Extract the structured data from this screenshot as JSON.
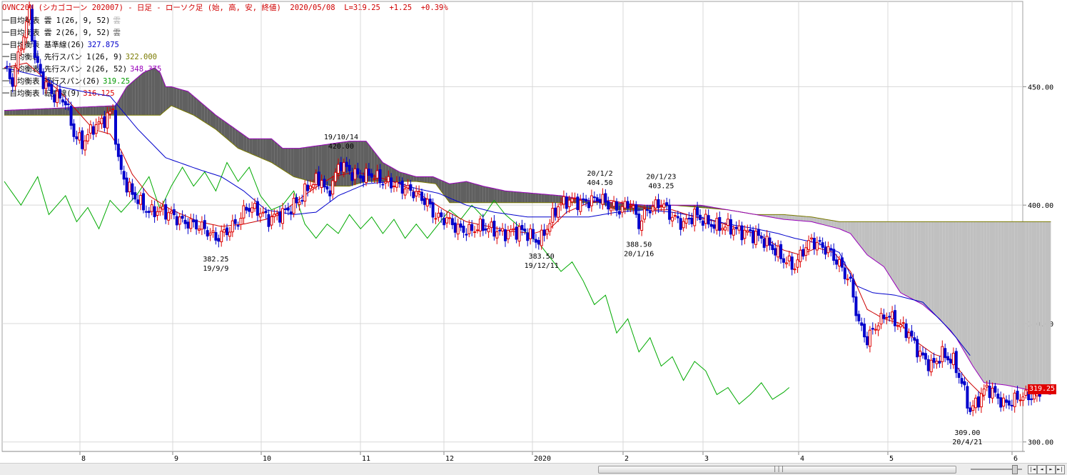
{
  "header": {
    "title": "OVNC20N (シカゴコーン 202007) - 日足 - ローソク足 (始, 高, 安, 終値)  2020/05/08  L=319.25  +1.25  +0.39%"
  },
  "legend": [
    {
      "label": "一目均衡表 雲 1(26, 9, 52)",
      "value": "雲",
      "color": "#b0b0b0"
    },
    {
      "label": "一目均衡表 雲 2(26, 9, 52)",
      "value": "雲",
      "color": "#606060"
    },
    {
      "label": "一目均衡表 基準線(26)",
      "value": "327.875",
      "color": "#0000cc"
    },
    {
      "label": "一目均衡表 先行スパン 1(26, 9)",
      "value": "322.000",
      "color": "#7a7a00"
    },
    {
      "label": "一目均衡表 先行スパン 2(26, 52)",
      "value": "348.375",
      "color": "#9900bb"
    },
    {
      "label": "一目均衡表 遅行スパン(26)",
      "value": "319.25",
      "color": "#009900"
    },
    {
      "label": "一目均衡表 転換線(9)",
      "value": "316.125",
      "color": "#dd0000"
    }
  ],
  "price_tag": "319.25",
  "scrollbar": {
    "grip": "|||"
  },
  "nav_buttons": [
    "|◄",
    "◄",
    "►",
    "►|"
  ],
  "colors": {
    "up_candle": "#dd0000",
    "down_candle": "#0000cc",
    "cloud_up": "#c0c0c0",
    "cloud_down": "#606060",
    "kijun": "#0000cc",
    "tenkan": "#cc0000",
    "chikou": "#00aa00",
    "senkou1": "#7a7a00",
    "senkou2": "#9900bb",
    "grid": "#d8d8d8"
  },
  "chart_data": {
    "type": "candlestick",
    "ylim": [
      296,
      486
    ],
    "y_ticks": [
      450,
      400,
      350,
      300
    ],
    "y_tick_labels": [
      "450.00",
      "400.00",
      "350.00",
      "300.00"
    ],
    "x_tick_labels": [
      "8",
      "9",
      "10",
      "11",
      "12",
      "2020",
      "2",
      "3",
      "4",
      "5",
      "6"
    ],
    "annotations": [
      {
        "text": "19/10/14",
        "bar": 121,
        "value": 420.0,
        "anchor": "above"
      },
      {
        "text": "420.00",
        "bar": 121,
        "value": 420.0,
        "anchor": "above2"
      },
      {
        "text": "20/1/2",
        "bar": 214,
        "value": 404.5,
        "anchor": "above"
      },
      {
        "text": "404.50",
        "bar": 214,
        "value": 404.5,
        "anchor": "above2"
      },
      {
        "text": "20/1/23",
        "bar": 236,
        "value": 403.25,
        "anchor": "above"
      },
      {
        "text": "403.25",
        "bar": 236,
        "value": 403.25,
        "anchor": "above2"
      },
      {
        "text": "382.25",
        "bar": 76,
        "value": 382.25,
        "anchor": "below"
      },
      {
        "text": "19/9/9",
        "bar": 76,
        "value": 382.25,
        "anchor": "below2"
      },
      {
        "text": "383.50",
        "bar": 193,
        "value": 383.5,
        "anchor": "below"
      },
      {
        "text": "19/12/11",
        "bar": 193,
        "value": 383.5,
        "anchor": "below2"
      },
      {
        "text": "388.50",
        "bar": 228,
        "value": 388.5,
        "anchor": "below"
      },
      {
        "text": "20/1/16",
        "bar": 228,
        "value": 388.5,
        "anchor": "below2"
      },
      {
        "text": "309.00",
        "bar": 346,
        "value": 309.0,
        "anchor": "below"
      },
      {
        "text": "20/4/21",
        "bar": 346,
        "value": 309.0,
        "anchor": "below2"
      }
    ],
    "anchors": [
      [
        0,
        458
      ],
      [
        3,
        452
      ],
      [
        6,
        468
      ],
      [
        8,
        476
      ],
      [
        9,
        482
      ],
      [
        11,
        462
      ],
      [
        14,
        452
      ],
      [
        18,
        446
      ],
      [
        22,
        444
      ],
      [
        25,
        430
      ],
      [
        28,
        426
      ],
      [
        32,
        433
      ],
      [
        35,
        435
      ],
      [
        39,
        440
      ],
      [
        41,
        418
      ],
      [
        44,
        408
      ],
      [
        48,
        402
      ],
      [
        52,
        397
      ],
      [
        56,
        398
      ],
      [
        60,
        396
      ],
      [
        64,
        393
      ],
      [
        68,
        392
      ],
      [
        72,
        390
      ],
      [
        76,
        386
      ],
      [
        80,
        389
      ],
      [
        84,
        393
      ],
      [
        87,
        399
      ],
      [
        91,
        398
      ],
      [
        95,
        394
      ],
      [
        99,
        396
      ],
      [
        102,
        398
      ],
      [
        106,
        402
      ],
      [
        110,
        409
      ],
      [
        114,
        411
      ],
      [
        116,
        404
      ],
      [
        119,
        413
      ],
      [
        121,
        418
      ],
      [
        124,
        414
      ],
      [
        128,
        412
      ],
      [
        132,
        413
      ],
      [
        136,
        410
      ],
      [
        140,
        409
      ],
      [
        144,
        407
      ],
      [
        148,
        405
      ],
      [
        152,
        401
      ],
      [
        155,
        395
      ],
      [
        159,
        394
      ],
      [
        163,
        390
      ],
      [
        167,
        389
      ],
      [
        171,
        391
      ],
      [
        175,
        390
      ],
      [
        179,
        388
      ],
      [
        183,
        389
      ],
      [
        187,
        389
      ],
      [
        191,
        385
      ],
      [
        193,
        386
      ],
      [
        196,
        393
      ],
      [
        199,
        400
      ],
      [
        203,
        402
      ],
      [
        207,
        401
      ],
      [
        211,
        402
      ],
      [
        214,
        403
      ],
      [
        217,
        400
      ],
      [
        221,
        398
      ],
      [
        225,
        401
      ],
      [
        228,
        392
      ],
      [
        231,
        398
      ],
      [
        236,
        401
      ],
      [
        240,
        395
      ],
      [
        244,
        392
      ],
      [
        248,
        396
      ],
      [
        252,
        393
      ],
      [
        256,
        391
      ],
      [
        260,
        391
      ],
      [
        264,
        389
      ],
      [
        268,
        388
      ],
      [
        272,
        386
      ],
      [
        276,
        382
      ],
      [
        280,
        377
      ],
      [
        284,
        374
      ],
      [
        287,
        381
      ],
      [
        290,
        385
      ],
      [
        293,
        383
      ],
      [
        296,
        381
      ],
      [
        300,
        375
      ],
      [
        304,
        367
      ],
      [
        307,
        350
      ],
      [
        310,
        343
      ],
      [
        313,
        349
      ],
      [
        317,
        354
      ],
      [
        321,
        350
      ],
      [
        325,
        346
      ],
      [
        329,
        337
      ],
      [
        333,
        332
      ],
      [
        337,
        337
      ],
      [
        341,
        334
      ],
      [
        344,
        325
      ],
      [
        347,
        313
      ],
      [
        350,
        318
      ],
      [
        353,
        323
      ],
      [
        356,
        320
      ],
      [
        359,
        316
      ],
      [
        362,
        317
      ],
      [
        365,
        319.25
      ]
    ],
    "tenkan_anchors": [
      [
        0,
        458
      ],
      [
        8,
        460
      ],
      [
        14,
        454
      ],
      [
        20,
        448
      ],
      [
        26,
        440
      ],
      [
        32,
        432
      ],
      [
        38,
        430
      ],
      [
        42,
        423
      ],
      [
        46,
        413
      ],
      [
        52,
        404
      ],
      [
        60,
        398
      ],
      [
        70,
        393
      ],
      [
        78,
        391
      ],
      [
        86,
        392
      ],
      [
        94,
        394
      ],
      [
        102,
        399
      ],
      [
        110,
        406
      ],
      [
        118,
        412
      ],
      [
        126,
        414
      ],
      [
        134,
        412
      ],
      [
        142,
        409
      ],
      [
        150,
        404
      ],
      [
        158,
        398
      ],
      [
        166,
        393
      ],
      [
        174,
        391
      ],
      [
        182,
        389
      ],
      [
        190,
        388
      ],
      [
        196,
        390
      ],
      [
        202,
        397
      ],
      [
        210,
        401
      ],
      [
        218,
        402
      ],
      [
        226,
        400
      ],
      [
        234,
        398
      ],
      [
        240,
        398
      ],
      [
        248,
        395
      ],
      [
        256,
        393
      ],
      [
        264,
        390
      ],
      [
        272,
        387
      ],
      [
        280,
        381
      ],
      [
        286,
        379
      ],
      [
        292,
        382
      ],
      [
        298,
        380
      ],
      [
        304,
        372
      ],
      [
        310,
        356
      ],
      [
        316,
        352
      ],
      [
        322,
        350
      ],
      [
        328,
        342
      ],
      [
        334,
        337
      ],
      [
        340,
        335
      ],
      [
        346,
        326
      ],
      [
        352,
        319
      ],
      [
        358,
        317
      ],
      [
        365,
        316
      ]
    ],
    "kijun_anchors": [
      [
        0,
        458
      ],
      [
        14,
        454
      ],
      [
        20,
        450
      ],
      [
        28,
        448
      ],
      [
        38,
        446
      ],
      [
        48,
        432
      ],
      [
        58,
        420
      ],
      [
        70,
        415
      ],
      [
        78,
        412
      ],
      [
        86,
        406
      ],
      [
        94,
        398
      ],
      [
        104,
        396
      ],
      [
        112,
        397
      ],
      [
        120,
        404
      ],
      [
        130,
        409
      ],
      [
        140,
        410
      ],
      [
        148,
        407
      ],
      [
        156,
        405
      ],
      [
        166,
        400
      ],
      [
        176,
        397
      ],
      [
        188,
        395
      ],
      [
        200,
        395
      ],
      [
        210,
        395
      ],
      [
        220,
        397
      ],
      [
        230,
        398
      ],
      [
        240,
        397
      ],
      [
        250,
        395
      ],
      [
        260,
        392
      ],
      [
        270,
        390
      ],
      [
        278,
        388
      ],
      [
        284,
        386
      ],
      [
        292,
        384
      ],
      [
        300,
        380
      ],
      [
        306,
        366
      ],
      [
        312,
        363
      ],
      [
        320,
        362
      ],
      [
        330,
        359
      ],
      [
        340,
        347
      ],
      [
        348,
        335
      ],
      [
        356,
        334
      ],
      [
        365,
        328
      ]
    ],
    "chikou_anchors": [
      [
        0,
        410
      ],
      [
        6,
        400
      ],
      [
        12,
        412
      ],
      [
        16,
        396
      ],
      [
        22,
        404
      ],
      [
        26,
        393
      ],
      [
        30,
        399
      ],
      [
        34,
        390
      ],
      [
        38,
        402
      ],
      [
        42,
        397
      ],
      [
        48,
        405
      ],
      [
        52,
        412
      ],
      [
        56,
        398
      ],
      [
        60,
        408
      ],
      [
        64,
        416
      ],
      [
        68,
        408
      ],
      [
        72,
        414
      ],
      [
        76,
        406
      ],
      [
        80,
        418
      ],
      [
        84,
        410
      ],
      [
        88,
        416
      ],
      [
        92,
        404
      ],
      [
        96,
        398
      ],
      [
        100,
        400
      ],
      [
        104,
        406
      ],
      [
        108,
        392
      ],
      [
        112,
        386
      ],
      [
        116,
        392
      ],
      [
        120,
        388
      ],
      [
        124,
        396
      ],
      [
        128,
        390
      ],
      [
        132,
        395
      ],
      [
        136,
        388
      ],
      [
        140,
        394
      ],
      [
        144,
        386
      ],
      [
        148,
        392
      ],
      [
        152,
        386
      ],
      [
        156,
        392
      ],
      [
        160,
        398
      ],
      [
        164,
        394
      ],
      [
        168,
        400
      ],
      [
        172,
        395
      ],
      [
        176,
        402
      ],
      [
        180,
        396
      ],
      [
        184,
        392
      ],
      [
        188,
        388
      ],
      [
        192,
        384
      ],
      [
        196,
        378
      ],
      [
        200,
        372
      ],
      [
        204,
        376
      ],
      [
        208,
        368
      ],
      [
        212,
        358
      ],
      [
        216,
        362
      ],
      [
        220,
        346
      ],
      [
        224,
        352
      ],
      [
        228,
        338
      ],
      [
        232,
        344
      ],
      [
        236,
        332
      ],
      [
        240,
        336
      ],
      [
        244,
        326
      ],
      [
        248,
        334
      ],
      [
        252,
        330
      ],
      [
        256,
        320
      ],
      [
        260,
        323
      ],
      [
        264,
        316
      ],
      [
        268,
        320
      ],
      [
        272,
        325
      ],
      [
        276,
        318
      ],
      [
        280,
        321
      ],
      [
        282,
        323
      ]
    ],
    "cloud_bounds": {
      "a": [
        [
          0,
          438
        ],
        [
          56,
          438
        ],
        [
          60,
          442
        ],
        [
          68,
          438
        ],
        [
          76,
          432
        ],
        [
          84,
          424
        ],
        [
          96,
          418
        ],
        [
          104,
          412
        ],
        [
          110,
          410
        ],
        [
          118,
          408
        ],
        [
          124,
          408
        ],
        [
          130,
          410
        ],
        [
          140,
          410
        ],
        [
          148,
          410
        ],
        [
          155,
          409
        ],
        [
          160,
          401
        ],
        [
          175,
          401
        ],
        [
          190,
          401
        ],
        [
          200,
          401
        ],
        [
          210,
          401
        ],
        [
          214,
          401
        ],
        [
          220,
          398
        ],
        [
          225,
          398
        ],
        [
          230,
          398
        ],
        [
          240,
          400
        ],
        [
          250,
          399
        ],
        [
          260,
          398
        ],
        [
          270,
          396
        ],
        [
          280,
          396
        ],
        [
          290,
          395
        ],
        [
          300,
          393
        ],
        [
          308,
          393
        ],
        [
          316,
          393
        ],
        [
          324,
          393
        ],
        [
          330,
          393
        ],
        [
          340,
          393
        ],
        [
          350,
          393
        ],
        [
          360,
          393
        ],
        [
          370,
          393
        ],
        [
          376,
          393
        ]
      ],
      "b": [
        [
          0,
          440
        ],
        [
          40,
          442
        ],
        [
          44,
          450
        ],
        [
          50,
          456
        ],
        [
          54,
          458
        ],
        [
          56,
          456
        ],
        [
          58,
          450
        ],
        [
          60,
          450
        ],
        [
          66,
          448
        ],
        [
          70,
          444
        ],
        [
          76,
          438
        ],
        [
          82,
          433
        ],
        [
          88,
          428
        ],
        [
          96,
          428
        ],
        [
          100,
          424
        ],
        [
          106,
          424
        ],
        [
          112,
          425
        ],
        [
          118,
          426
        ],
        [
          124,
          427
        ],
        [
          130,
          427
        ],
        [
          136,
          418
        ],
        [
          142,
          414
        ],
        [
          148,
          412
        ],
        [
          154,
          412
        ],
        [
          160,
          409
        ],
        [
          166,
          410
        ],
        [
          172,
          408
        ],
        [
          180,
          406
        ],
        [
          190,
          405
        ],
        [
          200,
          404
        ],
        [
          210,
          402
        ],
        [
          220,
          401
        ],
        [
          230,
          400
        ],
        [
          240,
          400
        ],
        [
          250,
          400
        ],
        [
          260,
          398
        ],
        [
          270,
          396
        ],
        [
          280,
          394
        ],
        [
          290,
          393
        ],
        [
          300,
          390
        ],
        [
          304,
          388
        ],
        [
          310,
          379
        ],
        [
          316,
          374
        ],
        [
          322,
          363
        ],
        [
          330,
          358
        ],
        [
          336,
          352
        ],
        [
          342,
          344
        ],
        [
          348,
          332
        ],
        [
          352,
          325
        ],
        [
          360,
          324
        ],
        [
          368,
          322
        ],
        [
          376,
          320
        ]
      ]
    },
    "cloud_top_bars": 376,
    "total_bars": 372
  }
}
